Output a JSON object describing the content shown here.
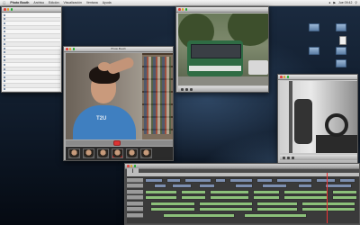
{
  "menubar": {
    "app": "Photo Booth",
    "items": [
      "Archivo",
      "Edición",
      "Visualización",
      "Ventana",
      "Ayuda"
    ],
    "clock": "Jue 09:42"
  },
  "windows": {
    "finder": {
      "title": "",
      "rows": [
        "",
        "",
        "",
        "",
        "",
        "",
        "",
        "",
        "",
        "",
        "",
        "",
        "",
        "",
        "",
        "",
        "",
        "",
        "",
        "",
        "",
        ""
      ]
    },
    "photo_booth": {
      "title": "Photo Booth",
      "shirt_text": "T2U",
      "thumbnails": 6
    },
    "video_top": {
      "title": ""
    },
    "video_inside": {
      "title": ""
    },
    "final_cut": {
      "title": "",
      "tabs": [
        "",
        ""
      ]
    }
  },
  "desktop_icons": [
    {
      "label": "",
      "kind": "folder"
    },
    {
      "label": "",
      "kind": "folder"
    },
    {
      "label": "",
      "kind": "doc"
    },
    {
      "label": "",
      "kind": "folder"
    },
    {
      "label": "",
      "kind": "folder"
    },
    {
      "label": "",
      "kind": "folder"
    }
  ],
  "colors": {
    "accent": "#3f7fc0",
    "record": "#d33333",
    "audio_clip": "#8cc07a",
    "video_clip": "#7d8fb0"
  }
}
